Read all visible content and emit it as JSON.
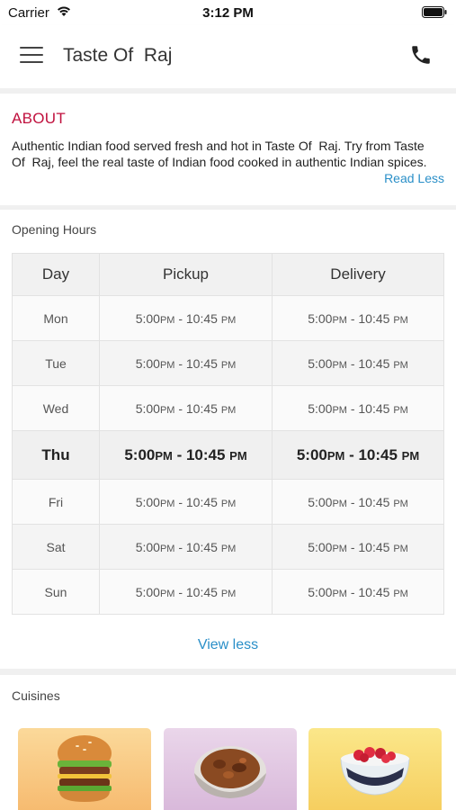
{
  "status_bar": {
    "carrier": "Carrier",
    "time": "3:12 PM"
  },
  "nav": {
    "title": "Taste Of  Raj"
  },
  "about": {
    "heading": "ABOUT",
    "text": "Authentic Indian food served fresh and hot in Taste Of  Raj. Try from Taste\nOf  Raj, feel the real taste of Indian food cooked in authentic Indian spices.",
    "read_less": "Read Less"
  },
  "hours": {
    "heading": "Opening Hours",
    "columns": [
      "Day",
      "Pickup",
      "Delivery"
    ],
    "rows": [
      {
        "day": "Mon",
        "pickup": "5:00",
        "pickup_ampm": "PM",
        "pickup_to": " - 10:45 ",
        "pickup_ampm2": "PM",
        "delivery": "5:00",
        "delivery_ampm": "PM",
        "delivery_to": " - 10:45 ",
        "delivery_ampm2": "PM"
      },
      {
        "day": "Tue",
        "pickup": "5:00",
        "pickup_ampm": "PM",
        "pickup_to": " - 10:45 ",
        "pickup_ampm2": "PM",
        "delivery": "5:00",
        "delivery_ampm": "PM",
        "delivery_to": " - 10:45 ",
        "delivery_ampm2": "PM"
      },
      {
        "day": "Wed",
        "pickup": "5:00",
        "pickup_ampm": "PM",
        "pickup_to": " - 10:45 ",
        "pickup_ampm2": "PM",
        "delivery": "5:00",
        "delivery_ampm": "PM",
        "delivery_to": " - 10:45 ",
        "delivery_ampm2": "PM"
      },
      {
        "day": "Thu",
        "pickup": "5:00",
        "pickup_ampm": "PM",
        "pickup_to": " - 10:45 ",
        "pickup_ampm2": "PM",
        "delivery": "5:00",
        "delivery_ampm": "PM",
        "delivery_to": " - 10:45 ",
        "delivery_ampm2": "PM"
      },
      {
        "day": "Fri",
        "pickup": "5:00",
        "pickup_ampm": "PM",
        "pickup_to": " - 10:45 ",
        "pickup_ampm2": "PM",
        "delivery": "5:00",
        "delivery_ampm": "PM",
        "delivery_to": " - 10:45 ",
        "delivery_ampm2": "PM"
      },
      {
        "day": "Sat",
        "pickup": "5:00",
        "pickup_ampm": "PM",
        "pickup_to": " - 10:45 ",
        "pickup_ampm2": "PM",
        "delivery": "5:00",
        "delivery_ampm": "PM",
        "delivery_to": " - 10:45 ",
        "delivery_ampm2": "PM"
      },
      {
        "day": "Sun",
        "pickup": "5:00",
        "pickup_ampm": "PM",
        "pickup_to": " - 10:45 ",
        "pickup_ampm2": "PM",
        "delivery": "5:00",
        "delivery_ampm": "PM",
        "delivery_to": " - 10:45 ",
        "delivery_ampm2": "PM"
      }
    ],
    "view_less": "View less"
  },
  "cuisines": {
    "heading": "Cuisines",
    "items": [
      {
        "icon": "burger-image"
      },
      {
        "icon": "curry-bowl-image"
      },
      {
        "icon": "dessert-bowl-image"
      }
    ]
  },
  "colors": {
    "accent_red": "#c0113e",
    "link_blue": "#2a8fc8"
  }
}
